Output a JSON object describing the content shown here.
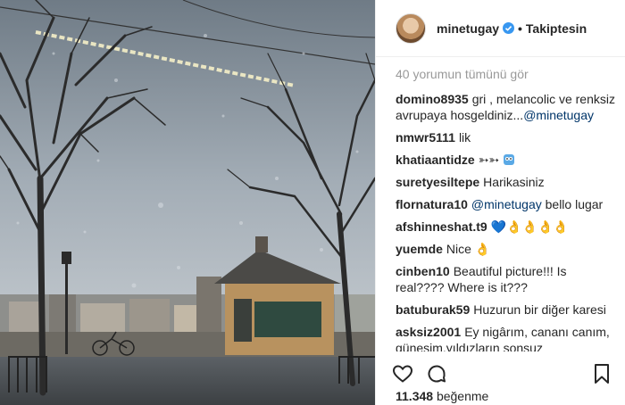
{
  "header": {
    "username": "minetugay",
    "separator": "•",
    "follow_status": "Takiptesin"
  },
  "comments": {
    "view_all": "40 yorumun tümünü gör",
    "items": [
      {
        "user": "domino8935",
        "text": "gri , melancolic ve renksiz avrupaya hosgeldiniz...",
        "mention": "@minetugay",
        "after": ""
      },
      {
        "user": "nmwr5111",
        "text": "lik",
        "mention": "",
        "after": ""
      },
      {
        "user": "khatiaantidze",
        "text": "➳➳",
        "mention": "",
        "after": ""
      },
      {
        "user": "suretyesiltepe",
        "text": "Harikasiniz",
        "mention": "",
        "after": ""
      },
      {
        "user": "flornatura10",
        "text": "",
        "mention": "@minetugay",
        "after": " bello lugar"
      },
      {
        "user": "afshinneshat.t9",
        "text": "💙👌👌👌👌",
        "mention": "",
        "after": ""
      },
      {
        "user": "yuemde",
        "text": "Nice 👌",
        "mention": "",
        "after": ""
      },
      {
        "user": "cinben10",
        "text": "Beautiful picture!!! Is real???? Where is it???",
        "mention": "",
        "after": ""
      },
      {
        "user": "batuburak59",
        "text": "Huzurun bir diğer karesi",
        "mention": "",
        "after": ""
      },
      {
        "user": "asksiz2001",
        "text": "Ey nigârım, cananı canım, güneşim,yıldızların sonsuz ışığı.visalından neden beni bu kadar uzak tutarsın? Bu gam hiç mi bitmez dersin?hiç mi affetmezsin şu ateş dolu vüredi?bilirim, her cümlemi , her",
        "mention": "",
        "after": ""
      }
    ]
  },
  "likes": {
    "count": "11.348",
    "label": "beğenme"
  },
  "icons": [
    "heart-icon",
    "comment-icon",
    "bookmark-icon",
    "verified-icon"
  ],
  "colors": {
    "accent": "#3897f0",
    "mention": "#003569",
    "muted": "#999999",
    "text": "#262626"
  }
}
